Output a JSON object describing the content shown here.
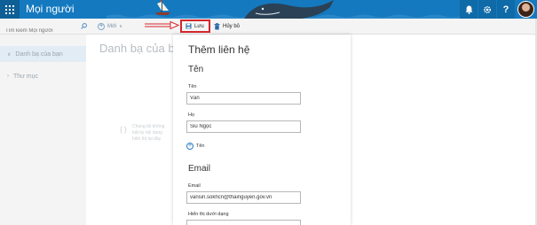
{
  "header": {
    "app_title": "Mọi người",
    "help_label": "?"
  },
  "toolbar": {
    "search_placeholder": "Tìm kiếm Mọi người",
    "new_label": "Mới",
    "save_label": "Lưu",
    "cancel_label": "Hủy bỏ"
  },
  "sidebar": {
    "items": [
      {
        "label": "Danh bạ của bạn"
      },
      {
        "label": "Thư mục"
      }
    ]
  },
  "main": {
    "title": "Danh bạ của bạn",
    "empty_lines": [
      "Chúng tôi không",
      "bất kỳ nội dung",
      "hiển thị tại đây"
    ]
  },
  "panel": {
    "title": "Thêm liên hệ",
    "name_section": "Tên",
    "first_name_label": "Tên",
    "first_name_value": "Văn",
    "last_name_label": "Họ",
    "last_name_value": "Siu Ngọc",
    "add_name_label": "Tên",
    "email_section": "Email",
    "email_label": "Email",
    "email_value": "vansin.sokhcn@thainguyen.gov.vn",
    "display_as_label": "Hiển thị dưới dạng"
  },
  "colors": {
    "header_blue": "#1479bf",
    "save_highlight": "#d6262c",
    "arrow": "#d6262c"
  },
  "icons": {
    "waffle": "app-launcher-icon",
    "bell": "bell-icon",
    "gear": "gear-icon",
    "search": "search-icon",
    "save": "floppy-disk-icon",
    "cancel": "trash-icon"
  }
}
